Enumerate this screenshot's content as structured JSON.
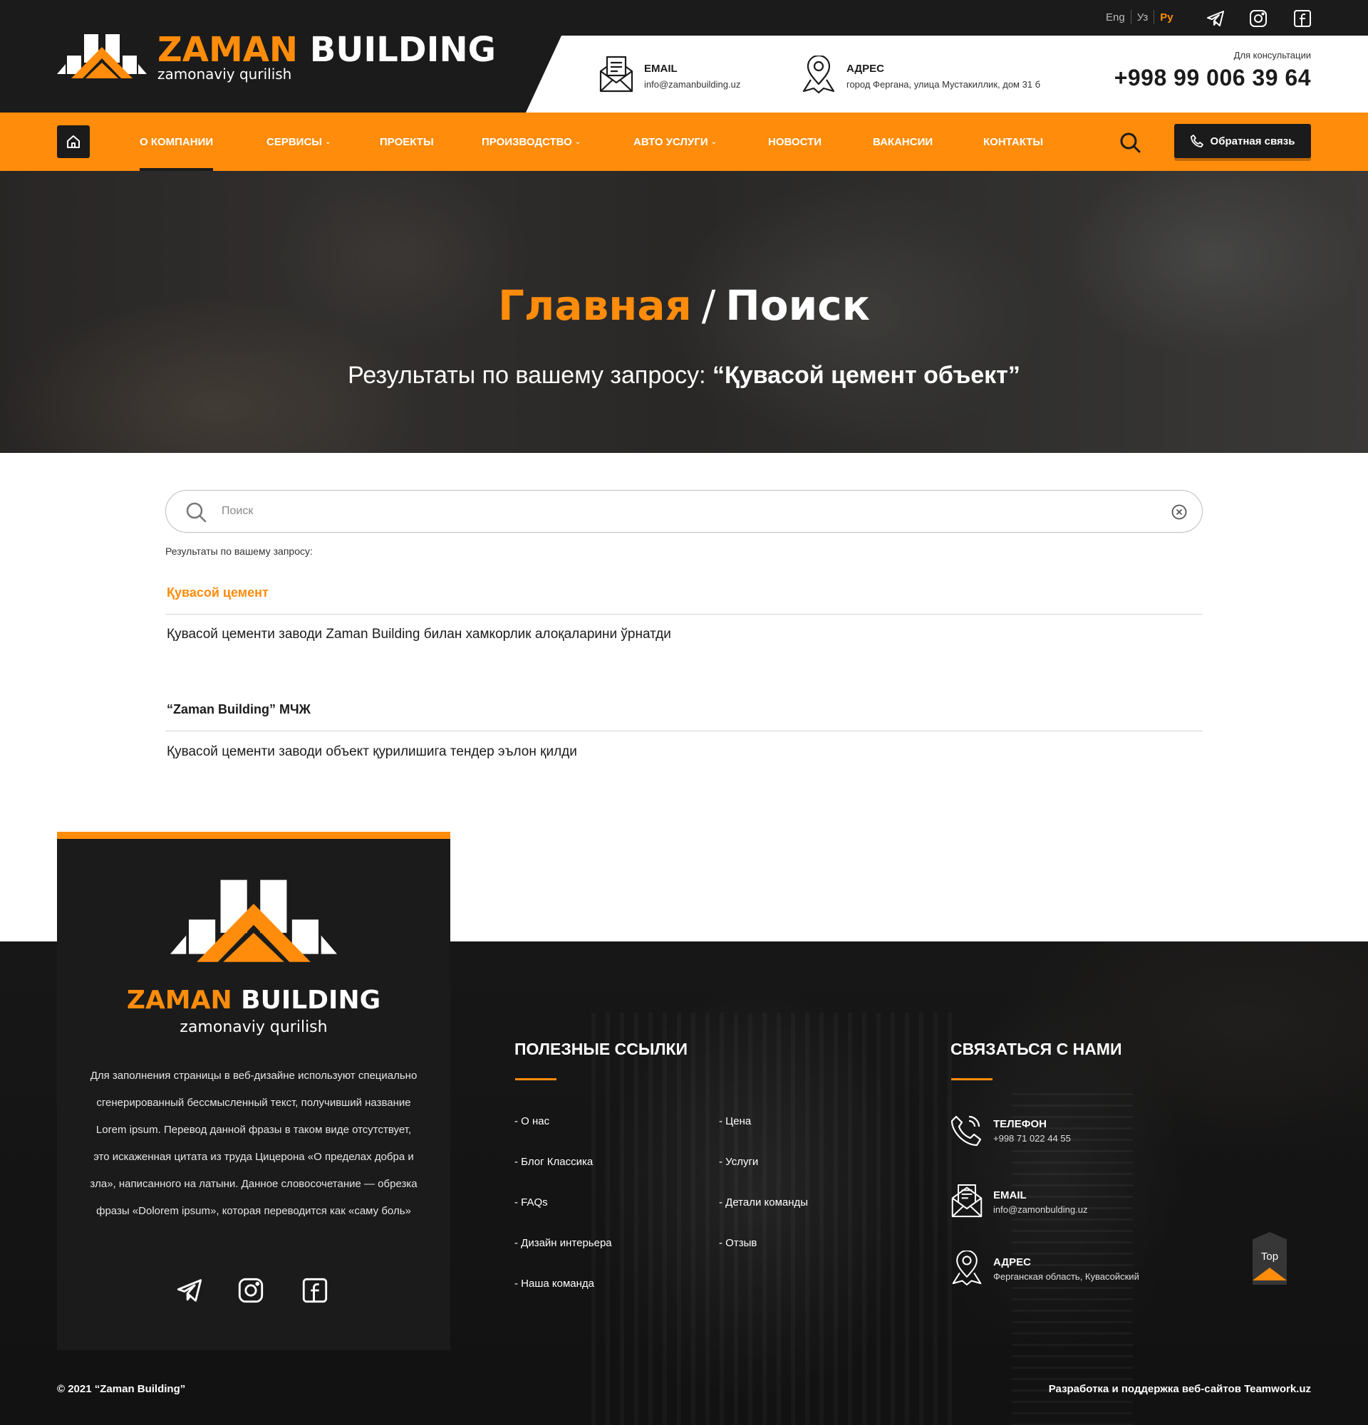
{
  "header": {
    "logo": {
      "name_orange": "ZAMAN",
      "name_white": "BUILDING",
      "tagline": "zamonaviy qurilish"
    },
    "languages": [
      {
        "label": "Eng",
        "active": false
      },
      {
        "label": "Уз",
        "active": false
      },
      {
        "label": "Ру",
        "active": true
      }
    ],
    "social_icons": [
      "telegram-icon",
      "instagram-icon",
      "facebook-icon"
    ],
    "email": {
      "title": "EMAIL",
      "value": "info@zamanbuilding.uz"
    },
    "address": {
      "title": "АДРЕС",
      "value": "город Фергана, улица Мустакиллик, дом 31 б"
    },
    "consult": {
      "label": "Для консультации",
      "phone": "+998 99 006 39 64"
    }
  },
  "nav": {
    "items": [
      {
        "label": "О КОМПАНИИ",
        "dropdown": false,
        "current": true
      },
      {
        "label": "СЕРВИСЫ",
        "dropdown": true,
        "current": false
      },
      {
        "label": "ПРОЕКТЫ",
        "dropdown": false,
        "current": false
      },
      {
        "label": "ПРОИЗВОДСТВО",
        "dropdown": true,
        "current": false
      },
      {
        "label": "АВТО УСЛУГИ",
        "dropdown": true,
        "current": false
      },
      {
        "label": "НОВОСТИ",
        "dropdown": false,
        "current": false
      },
      {
        "label": "ВАКАНСИИ",
        "dropdown": false,
        "current": false
      },
      {
        "label": "КОНТАКТЫ",
        "dropdown": false,
        "current": false
      }
    ],
    "callback_label": "Обратная связь",
    "caret": "⌄"
  },
  "hero": {
    "crumb_home": "Главная",
    "crumb_sep": "/",
    "crumb_current": "Поиск",
    "query_prefix": "Результаты по вашему запросу:",
    "query_value": "“Қувасой цемент объект”"
  },
  "search": {
    "placeholder": "Поиск",
    "value": "",
    "results_label": "Результаты по вашему запросу:"
  },
  "results": [
    {
      "title": "Қувасой цемент",
      "text": " Қувасой цементи заводи Zaman Building билан хамкорлик алоқаларини ўрнатди"
    },
    {
      "title": "“Zaman Building” МЧЖ",
      "text": "Қувасой цементи заводи объект қурилишига тендер эълон қилди"
    }
  ],
  "footer": {
    "card": {
      "name_orange": "ZAMAN",
      "name_white": "BUILDING",
      "tagline": "zamonaviy qurilish",
      "text": "Для заполнения страницы в веб-дизайне используют специально сгенерированный бессмысленный текст, получивший название Lorem ipsum. Перевод данной фразы в таком виде отсутствует, это искаженная цитата из труда Цицерона «О пределах добра и зла», написанного на латыни. Данное словосочетание — обрезка фразы «Dolorem ipsum», которая переводится как «саму боль»"
    },
    "links_title": "ПОЛЕЗНЫЕ ССЫЛКИ",
    "links_col1": [
      "- О нас",
      "- Блог Классика",
      "- FAQs",
      "- Дизайн интерьера",
      "- Наша команда"
    ],
    "links_col2": [
      "- Цена",
      "- Услуги",
      "- Детали команды",
      "- Отзыв"
    ],
    "contact_title": "СВЯЗАТЬСЯ С НАМИ",
    "contacts": [
      {
        "icon": "phone-icon",
        "title": "ТЕЛЕФОН",
        "value": "+998 71 022 44 55"
      },
      {
        "icon": "email-icon",
        "title": "EMAIL",
        "value": "info@zamonbulding.uz"
      },
      {
        "icon": "location-icon",
        "title": "АДРЕС",
        "value": "Ферганская область, Кувасойский"
      }
    ],
    "top_label": "Top",
    "copyright": "© 2021 “Zaman Building”",
    "developer": "Разработка и поддержка веб-сайтов Teamwork.uz"
  },
  "colors": {
    "accent": "#ff8c0b",
    "dark": "#1b1b1b",
    "white": "#ffffff"
  }
}
